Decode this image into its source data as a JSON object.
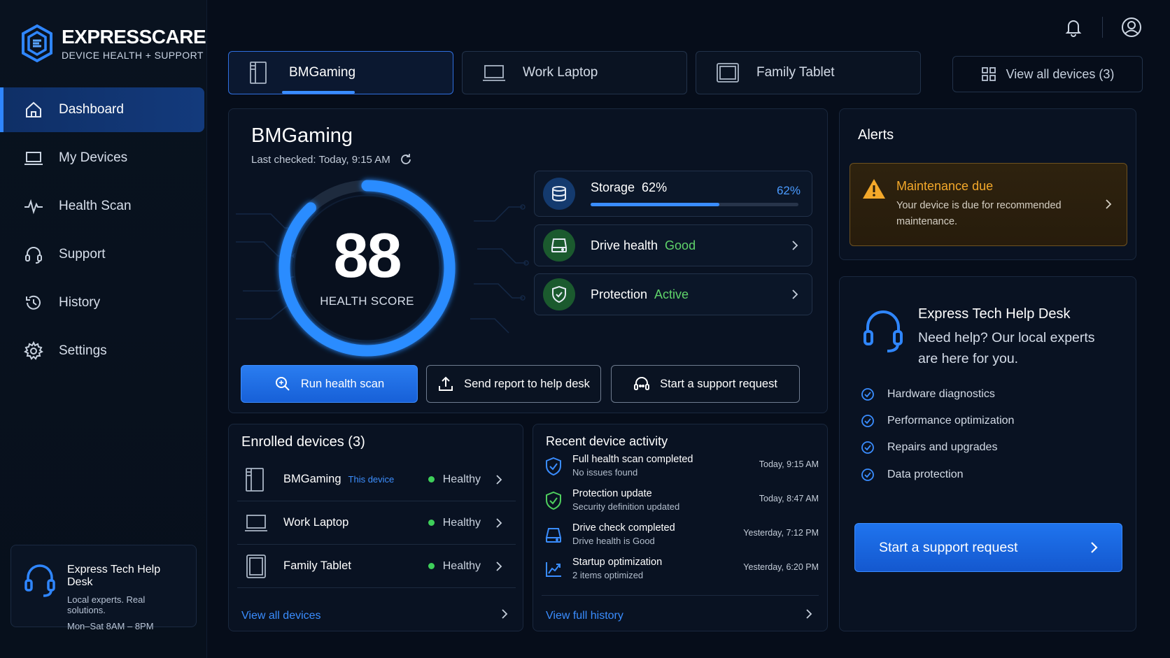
{
  "brand": {
    "name": "EXPRESSCARE",
    "tagline": "DEVICE HEALTH + SUPPORT"
  },
  "nav": [
    {
      "label": "Dashboard",
      "icon": "home-icon",
      "active": true
    },
    {
      "label": "My Devices",
      "icon": "laptop-icon"
    },
    {
      "label": "Health Scan",
      "icon": "pulse-icon"
    },
    {
      "label": "Support",
      "icon": "headset-icon"
    },
    {
      "label": "History",
      "icon": "history-icon"
    },
    {
      "label": "Settings",
      "icon": "gear-icon"
    }
  ],
  "sidebar_help": {
    "title": "Express Tech Help Desk",
    "line1": "Local experts. Real solutions.",
    "line2": "Mon–Sat  8AM – 8PM"
  },
  "device_tabs": [
    {
      "label": "BMGaming",
      "icon": "tower-pc-icon",
      "active": true
    },
    {
      "label": "Work Laptop",
      "icon": "laptop-icon"
    },
    {
      "label": "Family Tablet",
      "icon": "tablet-icon"
    }
  ],
  "view_all_devices": "View all devices (3)",
  "hero": {
    "device_name": "BMGaming",
    "last_checked": "Last checked: Today, 9:15 AM",
    "health_score": "88",
    "health_score_value": 88,
    "health_label": "HEALTH SCORE"
  },
  "stats": {
    "storage": {
      "label": "Storage",
      "inline_value": "62%",
      "pct_text": "62%",
      "fill": 0.62
    },
    "drive": {
      "label": "Drive health",
      "value": "Good"
    },
    "protection": {
      "label": "Protection",
      "value": "Active"
    }
  },
  "actions": {
    "run_scan": "Run health scan",
    "send_report": "Send report to help desk",
    "support": "Start a support request"
  },
  "enrolled": {
    "title": "Enrolled devices (3)",
    "items": [
      {
        "name": "BMGaming",
        "tag": "This device",
        "status": "Healthy"
      },
      {
        "name": "Work Laptop",
        "tag": "",
        "status": "Healthy"
      },
      {
        "name": "Family Tablet",
        "tag": "",
        "status": "Healthy"
      }
    ],
    "footer": "View all devices"
  },
  "activity": {
    "title": "Recent device activity",
    "items": [
      {
        "title": "Full health scan completed",
        "sub": "No issues found",
        "time": "Today, 9:15 AM",
        "icon": "shield-check-icon"
      },
      {
        "title": "Protection update",
        "sub": "Security definition updated",
        "time": "Today, 8:47 AM",
        "icon": "shield-green-icon"
      },
      {
        "title": "Drive check completed",
        "sub": "Drive health is Good",
        "time": "Yesterday, 7:12 PM",
        "icon": "drive-icon"
      },
      {
        "title": "Startup optimization",
        "sub": "2 items optimized",
        "time": "Yesterday, 6:20 PM",
        "icon": "chart-up-icon"
      }
    ],
    "footer": "View full history"
  },
  "alerts": {
    "title": "Alerts",
    "item": {
      "title": "Maintenance due",
      "text": "Your device is due for recommended maintenance."
    }
  },
  "helpdesk": {
    "title": "Express Tech Help Desk",
    "subtitle": "Need help? Our local experts are here for you.",
    "features": [
      "Hardware diagnostics",
      "Performance optimization",
      "Repairs and upgrades",
      "Data protection"
    ],
    "cta": "Start a support request"
  },
  "colors": {
    "accent": "#3a8dff",
    "good": "#5fd36a",
    "warning": "#f3a82a",
    "bg": "#060d1a"
  }
}
